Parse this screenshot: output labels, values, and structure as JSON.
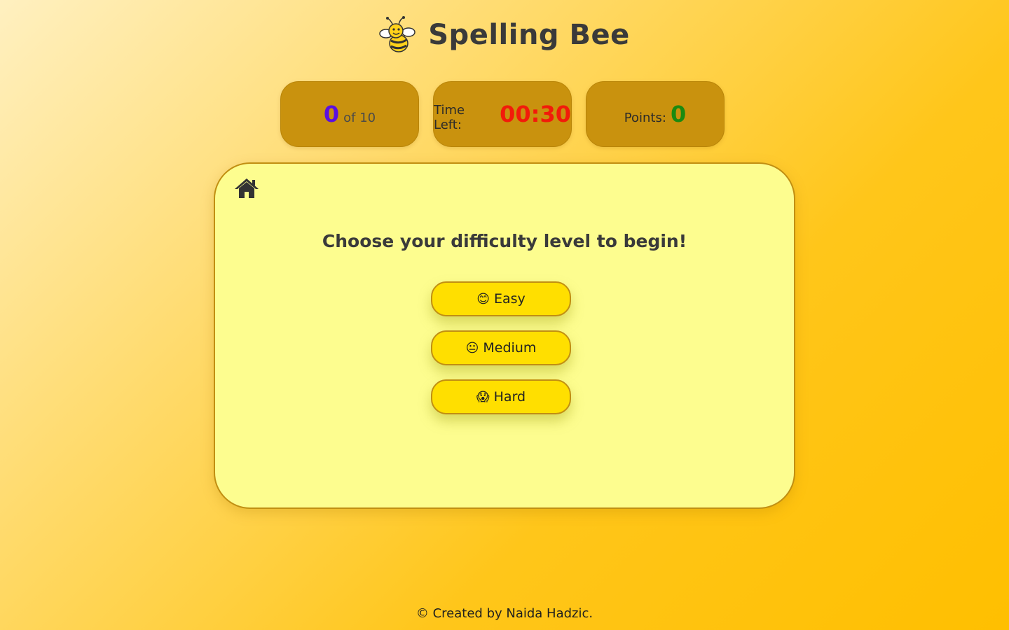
{
  "header": {
    "title": "Spelling Bee",
    "logo_icon": "bee-icon"
  },
  "stats": {
    "question_current": "0",
    "question_of": "of 10",
    "timer_label": "Time Left:",
    "timer_value": "00:30",
    "points_label": "Points:",
    "points_value": "0"
  },
  "card": {
    "home_icon": "home-icon",
    "prompt": "Choose your difficulty level to begin!",
    "buttons": [
      {
        "emoji": "😊",
        "label": "Easy"
      },
      {
        "emoji": "😐",
        "label": "Medium"
      },
      {
        "emoji": "😱",
        "label": "Hard"
      }
    ]
  },
  "footer": {
    "text": "© Created by Naida Hadzic."
  },
  "colors": {
    "question_number": "#5b10e0",
    "timer": "#f21b0a",
    "points": "#1a8a10",
    "card_bg": "#fdfd8f",
    "button_bg": "#ffdf00",
    "stat_bg": "#c9920e"
  }
}
